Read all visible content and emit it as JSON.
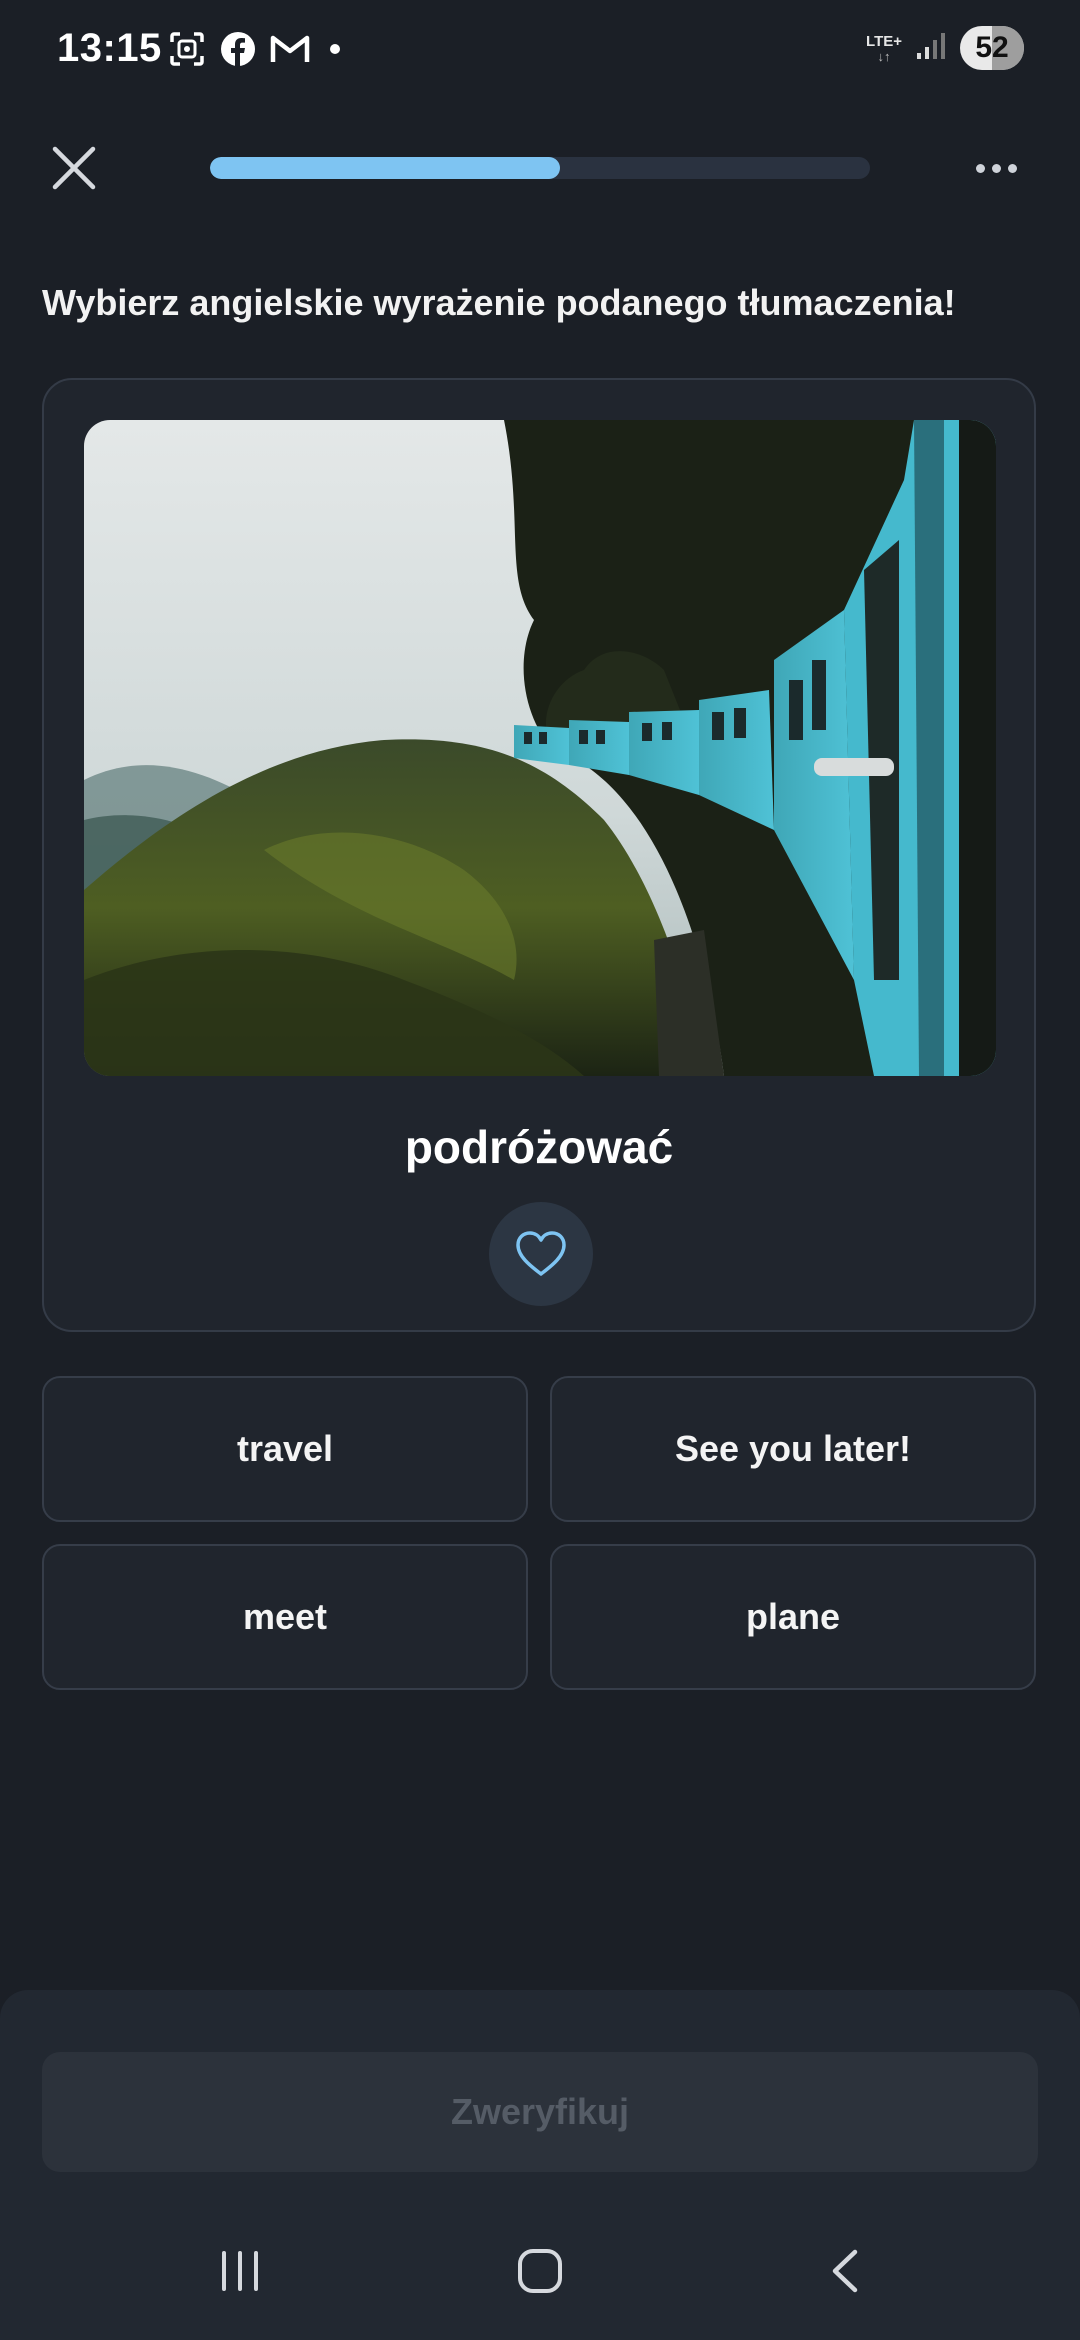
{
  "status_bar": {
    "time": "13:15",
    "network": "LTE+",
    "network_arrows": "↓↑",
    "battery": "52",
    "left_icons": [
      "screenshot-icon",
      "facebook-icon",
      "gmail-icon",
      "notification-dot"
    ],
    "right_icons": [
      "lte-icon",
      "signal-icon",
      "battery-icon"
    ]
  },
  "top_bar": {
    "close_icon": "close-icon",
    "progress": 0.53,
    "more_icon": "more-dots-icon"
  },
  "instruction": "Wybierz angielskie wyrażenie podanego tłumaczenia!",
  "card": {
    "image_icon": "train-photo",
    "word": "podróżować",
    "favorite_icon": "heart-icon"
  },
  "options": [
    {
      "label": "travel"
    },
    {
      "label": "See you later!"
    },
    {
      "label": "meet"
    },
    {
      "label": "plane"
    }
  ],
  "verify_button": {
    "label": "Zweryfikuj"
  },
  "nav_bar": {
    "items": [
      "recent-apps-icon",
      "home-icon",
      "back-icon"
    ]
  },
  "colors": {
    "background": "#1b1f26",
    "card": "#20252d",
    "accent": "#7ec4f2",
    "progress_track": "#2a3240",
    "verify_disabled_text": "#555c66"
  }
}
